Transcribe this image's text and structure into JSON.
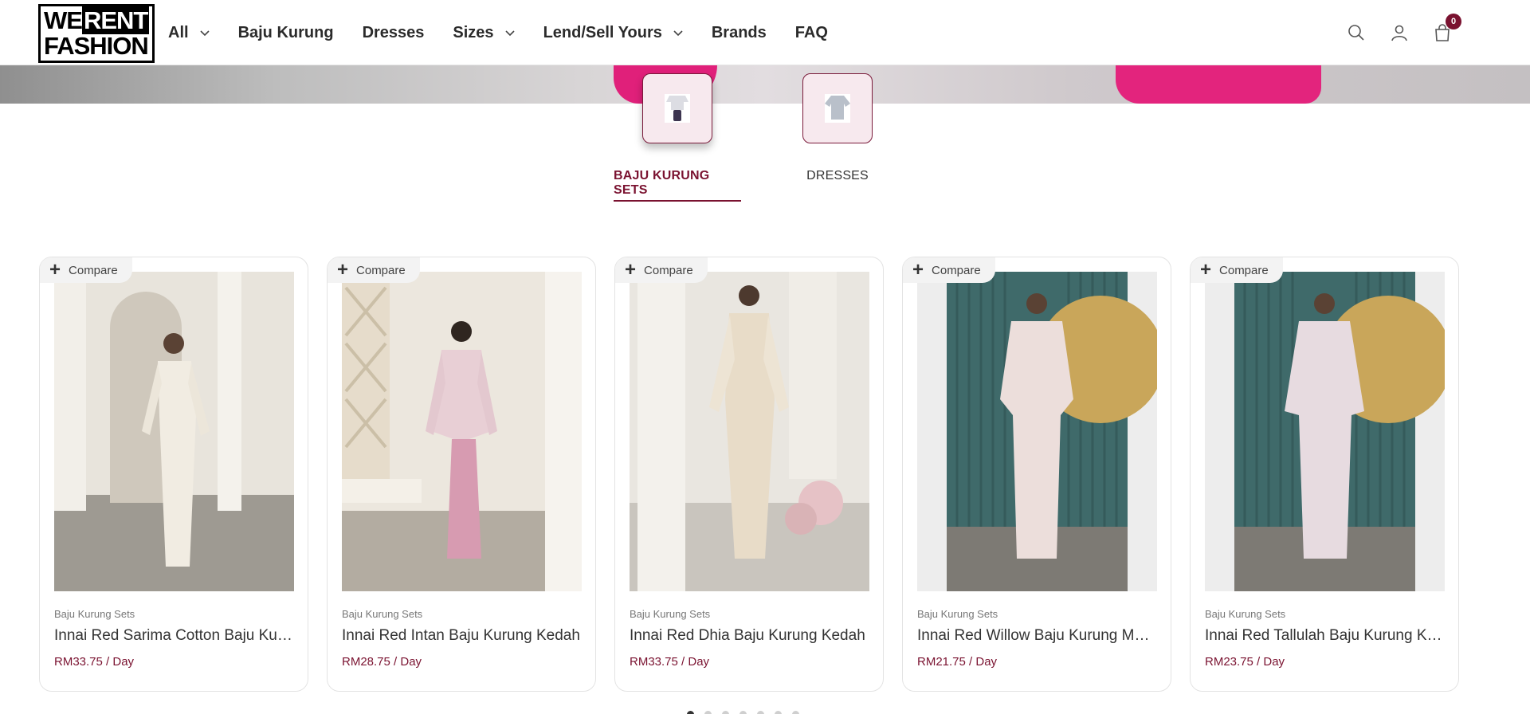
{
  "logo": {
    "line1_a": "WE",
    "line1_b": "RENT",
    "line2": "FASHION"
  },
  "nav": [
    {
      "label": "All",
      "has_dropdown": true
    },
    {
      "label": "Baju Kurung",
      "has_dropdown": false
    },
    {
      "label": "Dresses",
      "has_dropdown": false
    },
    {
      "label": "Sizes",
      "has_dropdown": true
    },
    {
      "label": "Lend/Sell Yours",
      "has_dropdown": true
    },
    {
      "label": "Brands",
      "has_dropdown": false
    },
    {
      "label": "FAQ",
      "has_dropdown": false
    }
  ],
  "header_icons": {
    "search": "search-icon",
    "account": "user-icon",
    "cart": "shopping-bag-icon",
    "cart_count": "0"
  },
  "categories": [
    {
      "label": "BAJU KURUNG SETS",
      "active": true
    },
    {
      "label": "DRESSES",
      "active": false
    }
  ],
  "compare_label": "Compare",
  "products": [
    {
      "category": "Baju Kurung Sets",
      "title": "Innai Red Sarima Cotton Baju Kurung Kedah",
      "price": "RM33.75 / Day"
    },
    {
      "category": "Baju Kurung Sets",
      "title": "Innai Red Intan Baju Kurung Kedah",
      "price": "RM28.75 / Day"
    },
    {
      "category": "Baju Kurung Sets",
      "title": "Innai Red Dhia Baju Kurung Kedah",
      "price": "RM33.75 / Day"
    },
    {
      "category": "Baju Kurung Sets",
      "title": "Innai Red Willow Baju Kurung Moden",
      "price": "RM21.75 / Day"
    },
    {
      "category": "Baju Kurung Sets",
      "title": "Innai Red Tallulah Baju Kurung Kedah",
      "price": "RM23.75 / Day"
    }
  ],
  "carousel": {
    "pages": 7,
    "current": 1
  },
  "colors": {
    "accent": "#7a1230",
    "hero_pink": "#e0207a"
  }
}
